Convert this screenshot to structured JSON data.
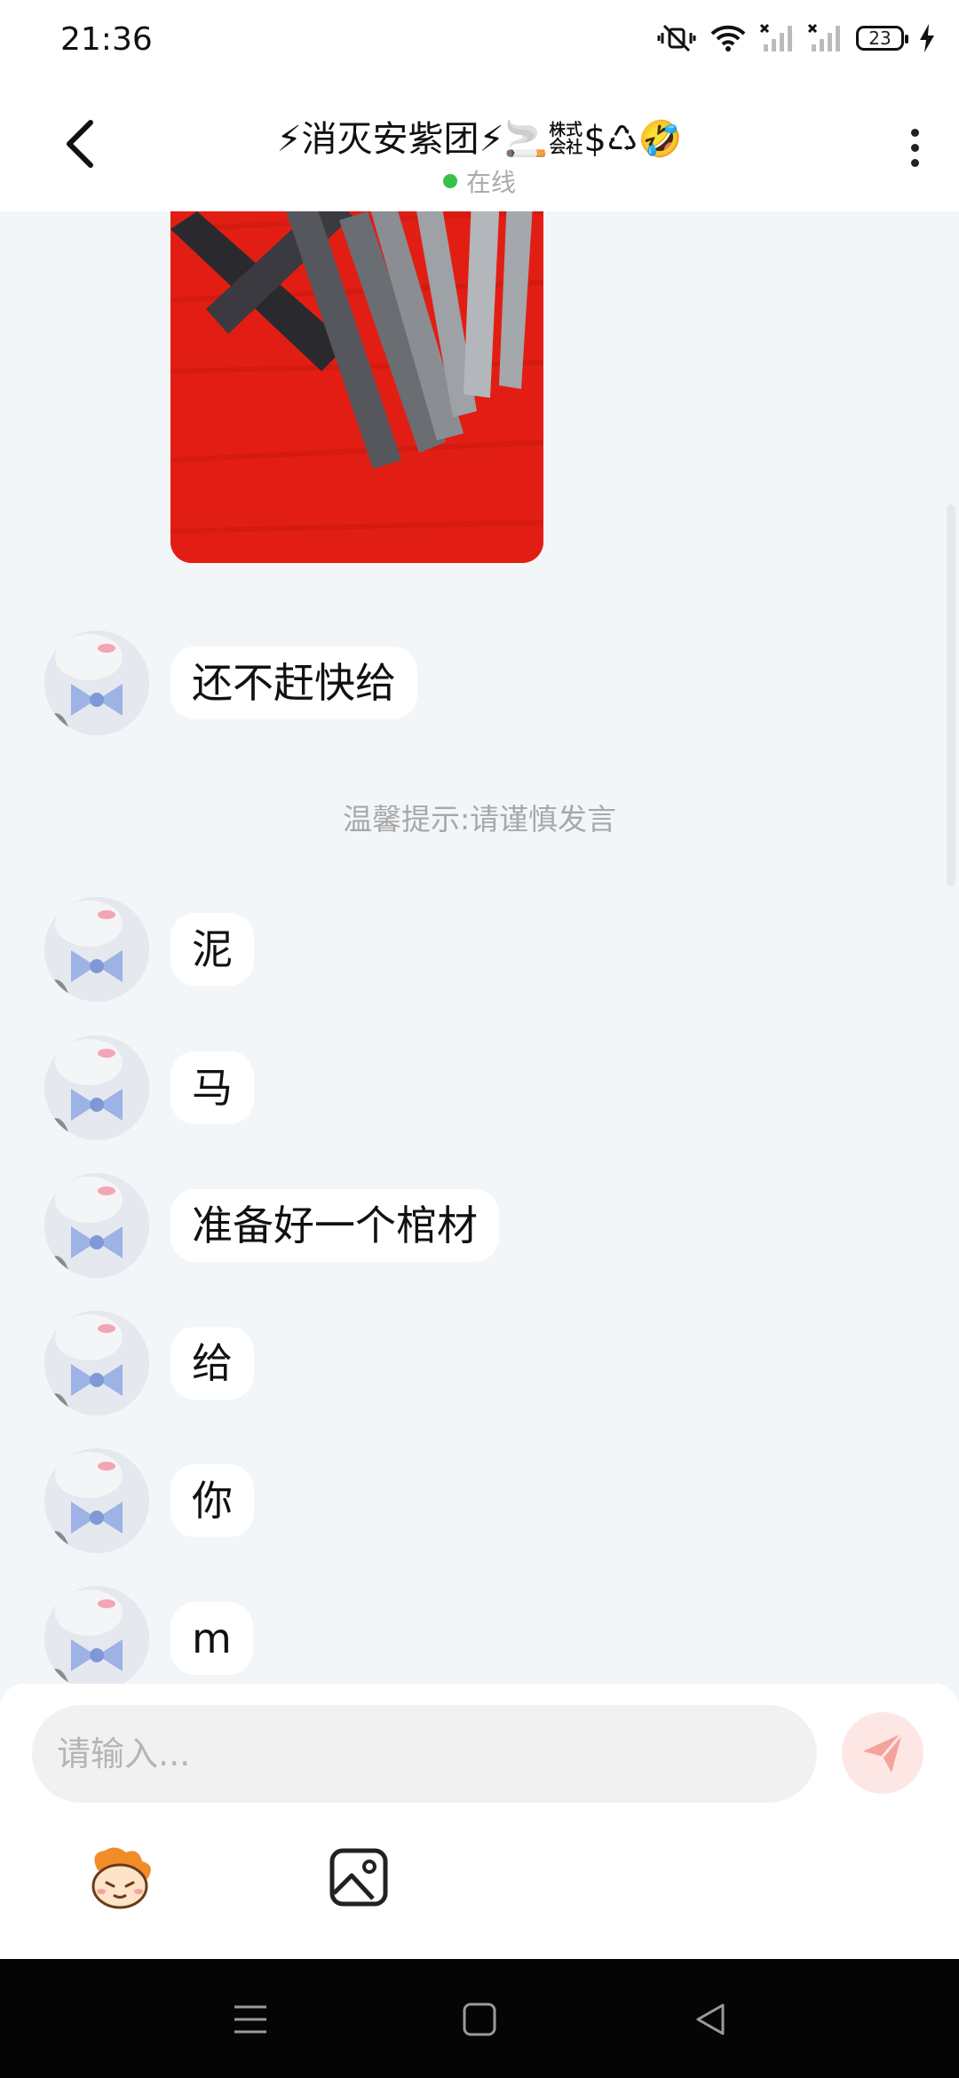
{
  "status_bar": {
    "time": "21:36",
    "battery_level": "23",
    "icons": [
      "mute-vibrate-icon",
      "wifi-icon",
      "signal-no-service-icon",
      "signal-no-service-icon",
      "battery-icon",
      "charging-icon"
    ]
  },
  "header": {
    "title": "⚡消灭安紫团⚡🚬㍿$♺🤣",
    "status_text": "在线",
    "status_color": "#35c24b"
  },
  "messages": [
    {
      "text": "还不赶快给"
    },
    {
      "text": "泥"
    },
    {
      "text": "马"
    },
    {
      "text": "准备好一个棺材"
    },
    {
      "text": "给"
    },
    {
      "text": "你"
    },
    {
      "text": "m"
    }
  ],
  "notice": "温馨提示:请谨慎发言",
  "composer": {
    "placeholder": "请输入...",
    "send_icon": "paper-plane-icon",
    "tools": [
      "emoji-avatar-icon",
      "image-icon"
    ]
  },
  "nav_bar": {
    "buttons": [
      "menu-icon",
      "home-icon",
      "back-triangle-icon"
    ]
  },
  "colors": {
    "background": "#f3f6f9",
    "accent_send": "#f07a70",
    "photo_bg": "#e21e14"
  }
}
